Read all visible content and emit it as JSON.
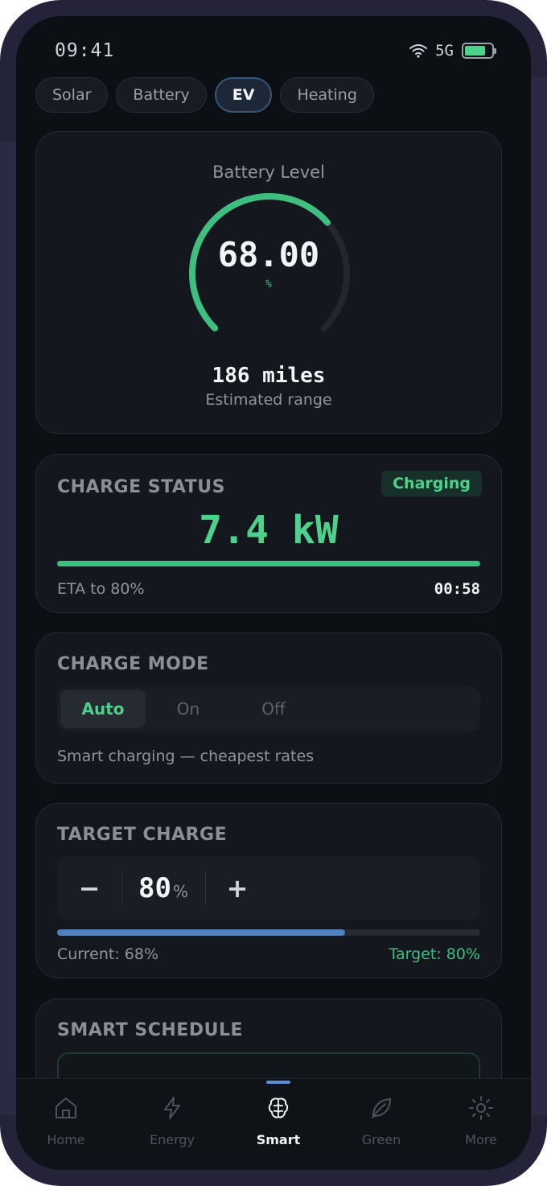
{
  "status_bar": {
    "time": "09:41",
    "network": "5G"
  },
  "tabs": [
    {
      "label": "Solar"
    },
    {
      "label": "Battery"
    },
    {
      "label": "EV",
      "active": true
    },
    {
      "label": "Heating"
    }
  ],
  "battery_level": {
    "title": "Battery Level",
    "value": "68.00",
    "unit": "%",
    "fraction": 0.68,
    "range_value": "186 miles",
    "range_label": "Estimated range"
  },
  "charge_status": {
    "title": "CHARGE STATUS",
    "badge": "Charging",
    "power": "7.4 kW",
    "progress": 1.0,
    "eta_label": "ETA to 80%",
    "eta_value": "00:58"
  },
  "charge_mode": {
    "title": "CHARGE MODE",
    "options": [
      "Auto",
      "On",
      "Off"
    ],
    "selected": "Auto",
    "description": "Smart charging — cheapest rates"
  },
  "target_charge": {
    "title": "TARGET CHARGE",
    "minus": "−",
    "plus": "+",
    "value": "80",
    "unit": "%",
    "current_fraction": 0.68,
    "current_label": "Current: 68%",
    "target_label": "Target: 80%"
  },
  "smart_schedule": {
    "title": "SMART SCHEDULE"
  },
  "bottom_nav": [
    {
      "label": "Home",
      "icon": "home-icon"
    },
    {
      "label": "Energy",
      "icon": "lightning-icon"
    },
    {
      "label": "Smart",
      "icon": "brain-icon",
      "active": true
    },
    {
      "label": "Green",
      "icon": "leaf-icon"
    },
    {
      "label": "More",
      "icon": "sun-icon"
    }
  ],
  "colors": {
    "accent_green": "#4cd28a",
    "accent_blue": "#4f80bf",
    "background": "#0c0f14",
    "card": "#14171d"
  }
}
